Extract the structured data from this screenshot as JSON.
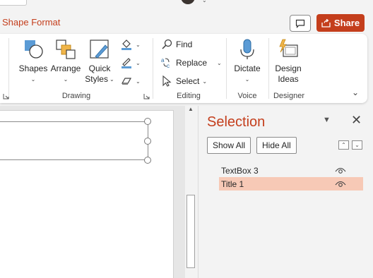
{
  "tab": {
    "label": "Shape Format"
  },
  "share": {
    "label": "Share"
  },
  "ribbon": {
    "drawing": {
      "label": "Drawing",
      "shapes": "Shapes",
      "arrange": "Arrange",
      "quick_styles_line1": "Quick",
      "quick_styles_line2": "Styles"
    },
    "editing": {
      "label": "Editing",
      "find": "Find",
      "replace": "Replace",
      "select": "Select"
    },
    "voice": {
      "label": "Voice",
      "dictate": "Dictate"
    },
    "designer": {
      "label": "Designer",
      "design_line1": "Design",
      "design_line2": "Ideas"
    }
  },
  "pane": {
    "title": "Selection",
    "show_all": "Show All",
    "hide_all": "Hide All",
    "items": [
      {
        "label": "TextBox 3",
        "selected": false
      },
      {
        "label": "Title 1",
        "selected": true
      }
    ]
  },
  "colors": {
    "accent": "#c43e1c",
    "selected_row": "#f7c9b6"
  }
}
